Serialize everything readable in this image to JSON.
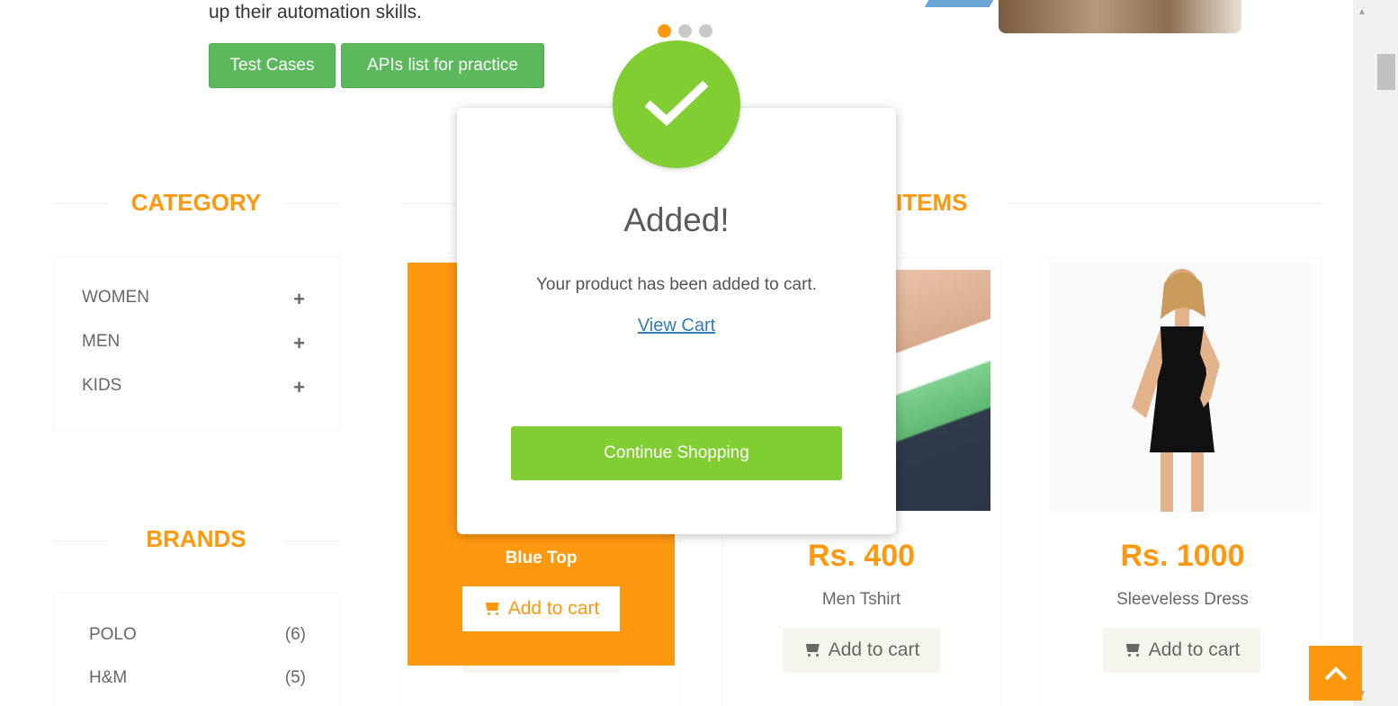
{
  "hero": {
    "text": "up their automation skills.",
    "btn_test_cases": "Test Cases",
    "btn_apis": "APIs list for practice"
  },
  "sections": {
    "category": "CATEGORY",
    "features": "ITEMS",
    "brands": "BRANDS"
  },
  "categories": [
    {
      "label": "WOMEN",
      "icon": "+"
    },
    {
      "label": "MEN",
      "icon": "+"
    },
    {
      "label": "KIDS",
      "icon": "+"
    }
  ],
  "brands": [
    {
      "label": "POLO",
      "count": "(6)"
    },
    {
      "label": "H&M",
      "count": "(5)"
    }
  ],
  "products": [
    {
      "name": "Blue Top",
      "cart": "Add to cart"
    },
    {
      "price": "Rs. 400",
      "name": "Men Tshirt",
      "cart": "Add to cart"
    },
    {
      "price": "Rs. 1000",
      "name": "Sleeveless Dress",
      "cart": "Add to cart"
    }
  ],
  "modal": {
    "title": "Added!",
    "text": "Your product has been added to cart.",
    "link": "View Cart",
    "button": "Continue Shopping"
  },
  "colors": {
    "accent": "#fe980f",
    "success": "#81ce33",
    "hero_button": "#5cb85c"
  }
}
